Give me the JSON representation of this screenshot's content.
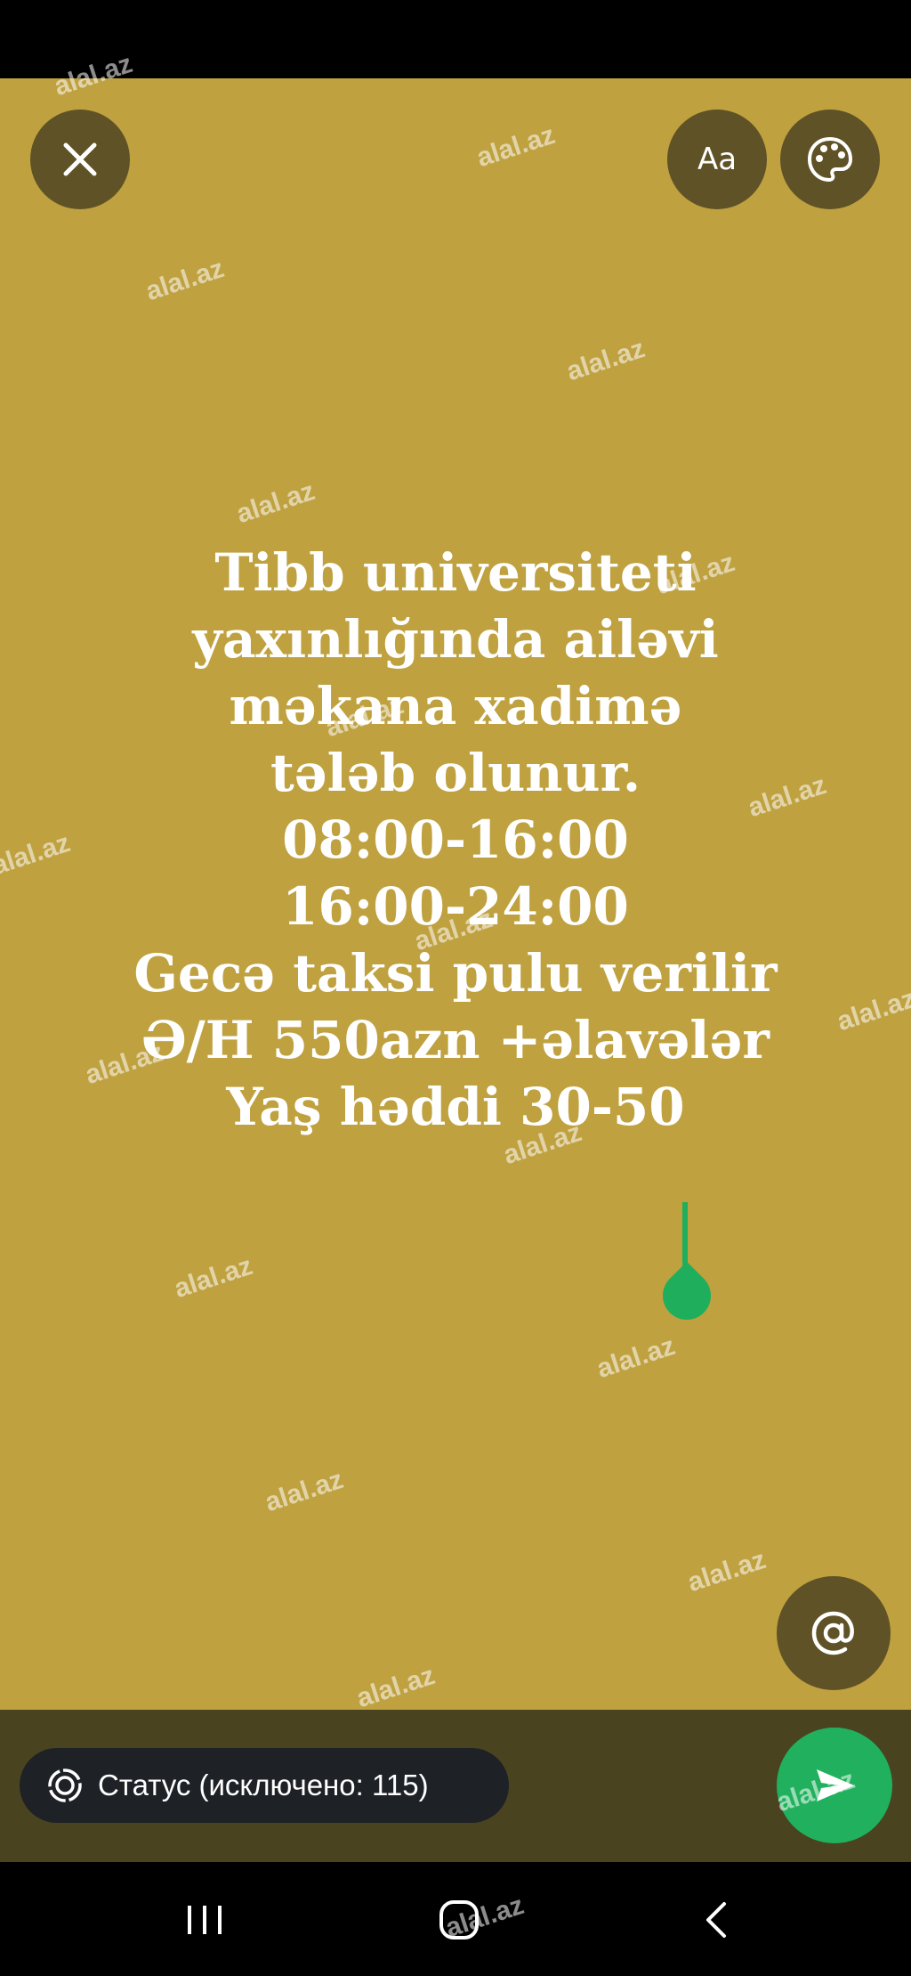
{
  "toolbar": {
    "font_button_label": "Aa"
  },
  "status_text": {
    "lines": [
      "Tibb universiteti",
      "yaxınlığında ailəvi",
      "məkana xadimə",
      "tələb olunur.",
      "08:00-16:00",
      "16:00-24:00",
      "Gecə taksi pulu verilir",
      "Ə/H 550azn +əlavələr",
      "Yaş həddi 30-50"
    ]
  },
  "audience": {
    "label": "Статус (исключено: 115)"
  },
  "watermark": "alal.az",
  "colors": {
    "background": "#bfa140",
    "button": "#5f5226",
    "accent_green": "#21b15e",
    "panel": "#4a4320",
    "pill": "#1e2125"
  },
  "icons": {
    "close": "close-icon",
    "font": "text-style-icon",
    "palette": "palette-icon",
    "mention": "at-sign-icon",
    "audience": "status-ring-icon",
    "send": "send-icon",
    "nav_recents": "recents-icon",
    "nav_home": "home-icon",
    "nav_back": "back-icon"
  }
}
